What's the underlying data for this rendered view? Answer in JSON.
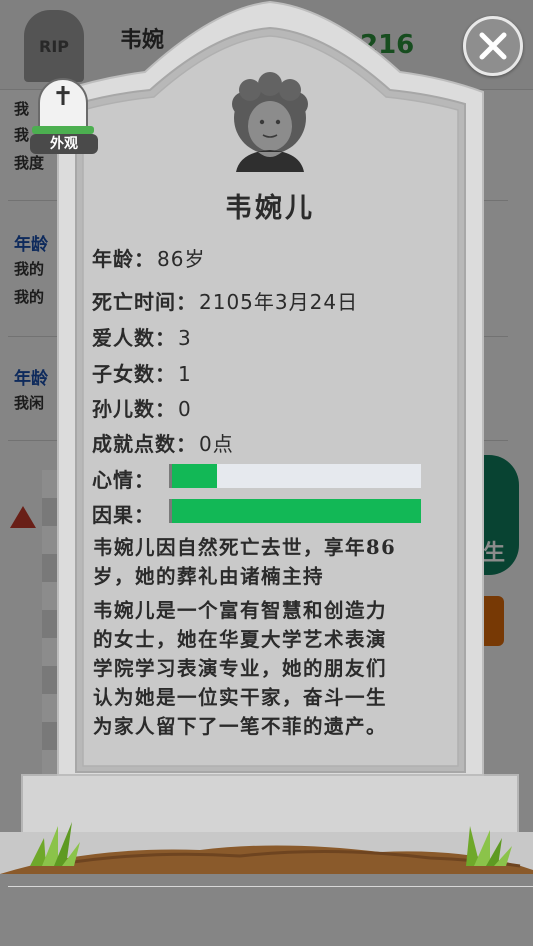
{
  "background": {
    "rip_text": "RIP",
    "name_partial": "韦婉",
    "score_partial": "216",
    "lines": [
      "我",
      "我",
      "我度"
    ],
    "age_label_1": "年龄",
    "lines_2": [
      "我的",
      "我的"
    ],
    "age_label_2": "年龄",
    "lines_3": [
      "我闲"
    ],
    "green_button_partial": "生"
  },
  "appearance_button": {
    "icon": "cross-icon",
    "label": "外观"
  },
  "close_button": {
    "icon": "close-icon"
  },
  "tombstone": {
    "avatar_icon": "elderly-woman-avatar",
    "name": "韦婉儿",
    "age_label": "年龄：",
    "age_value": "86岁",
    "death_label": "死亡时间：",
    "death_value": "2105年3月24日",
    "lovers_label": "爱人数：",
    "lovers_value": "3",
    "children_label": "子女数：",
    "children_value": "1",
    "grandchildren_label": "孙儿数：",
    "grandchildren_value": "0",
    "achievements_label": "成就点数：",
    "achievements_value": "0点",
    "mood_label": "心情：",
    "mood_level": 0.18,
    "karma_label": "因果：",
    "karma_level": 1.0,
    "death_paragraph_line1": "韦婉儿因自然死亡去世，享年86",
    "death_paragraph_line2": "岁，她的葬礼由诸楠主持",
    "bio_lines": [
      "韦婉儿是一个富有智慧和创造力",
      "的女士，她在华夏大学艺术表演",
      "学院学习表演专业，她的朋友们",
      "认为她是一位实干家，奋斗一生",
      "为家人留下了一笔不菲的遗产。"
    ]
  },
  "colors": {
    "bar_fill": "#12b856",
    "bar_empty": "#e6e9ee",
    "stone": "#c9c9c9",
    "soil": "#8a5a2b"
  }
}
